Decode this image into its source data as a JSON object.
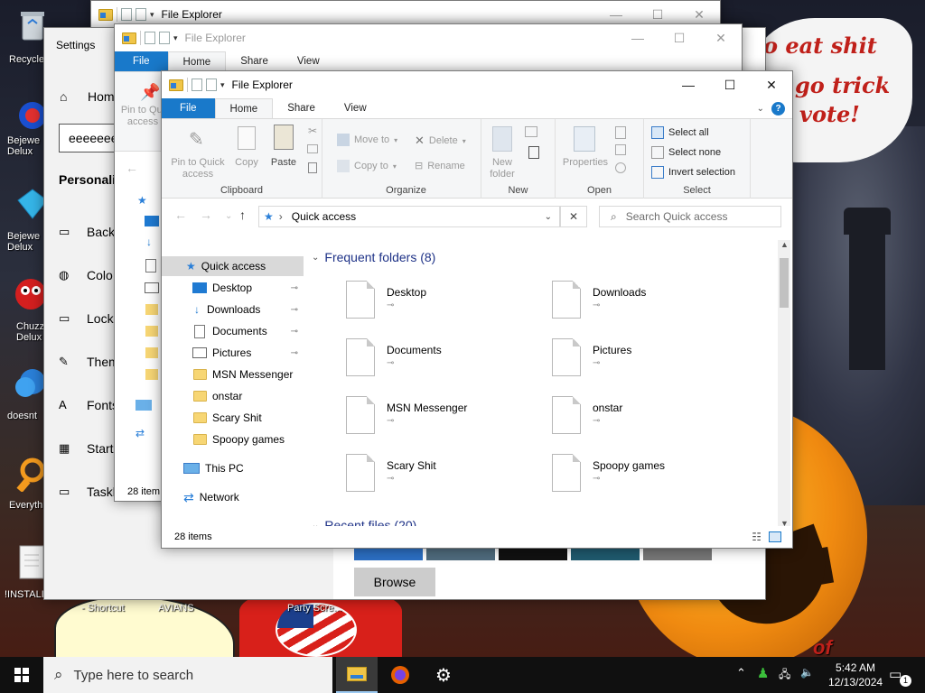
{
  "desktop": {
    "speech_lines": [
      "o eat shit",
      "go trick",
      "vote!"
    ],
    "icons": [
      {
        "label": "Recycle"
      },
      {
        "label": "Bejewe\nDelux"
      },
      {
        "label": "Bejewe\nDelux"
      },
      {
        "label": "Chuzz\nDelux"
      },
      {
        "label": "doesnt"
      },
      {
        "label": "Everyth"
      },
      {
        "label": "!INSTALI"
      }
    ],
    "bottom_labels": [
      "- Shortcut",
      "AVIANS",
      "Party Scre..."
    ],
    "corner_text": "of"
  },
  "back_explorer": {
    "title": "File Explorer"
  },
  "mid_explorer": {
    "title": "File Explorer",
    "tabs": [
      "File",
      "Home",
      "Share",
      "View"
    ],
    "pin_label": "Pin to Qui\naccess",
    "status": "28 item"
  },
  "settings": {
    "title": "Settings",
    "home": "Hom",
    "search_value": "eeeeeee",
    "section": "Personaliz",
    "items": [
      "Backg",
      "Colo",
      "Lock",
      "Them",
      "Fonts",
      "Start",
      "Taskb"
    ],
    "browse": "Browse"
  },
  "front_explorer": {
    "title": "File Explorer",
    "tabs": {
      "file": "File",
      "home": "Home",
      "share": "Share",
      "view": "View"
    },
    "ribbon": {
      "clipboard": {
        "label": "Clipboard",
        "pin": "Pin to Quick\naccess",
        "copy": "Copy",
        "paste": "Paste"
      },
      "organize": {
        "label": "Organize",
        "move_to": "Move to",
        "copy_to": "Copy to",
        "delete": "Delete",
        "rename": "Rename"
      },
      "new": {
        "label": "New",
        "new_folder": "New\nfolder"
      },
      "open": {
        "label": "Open",
        "properties": "Properties"
      },
      "select": {
        "label": "Select",
        "select_all": "Select all",
        "select_none": "Select none",
        "invert": "Invert selection"
      }
    },
    "address": {
      "path": "Quick access",
      "search_placeholder": "Search Quick access"
    },
    "nav": {
      "quick_access": "Quick access",
      "pinned": [
        "Desktop",
        "Downloads",
        "Documents",
        "Pictures"
      ],
      "folders": [
        "MSN Messenger",
        "onstar",
        "Scary Shit",
        "Spoopy games"
      ],
      "this_pc": "This PC",
      "network": "Network"
    },
    "content": {
      "frequent_header": "Frequent folders (8)",
      "recent_header": "Recent files (20)",
      "tiles": [
        "Desktop",
        "Downloads",
        "Documents",
        "Pictures",
        "MSN Messenger",
        "onstar",
        "Scary Shit",
        "Spoopy games"
      ]
    },
    "status": "28 items"
  },
  "taskbar": {
    "search_placeholder": "Type here to search",
    "time": "5:42 AM",
    "date": "12/13/2024",
    "notification_count": "1"
  },
  "colors": {
    "accent": "#1979ca",
    "selection": "#cce8ff",
    "taskbar": "#101010"
  }
}
